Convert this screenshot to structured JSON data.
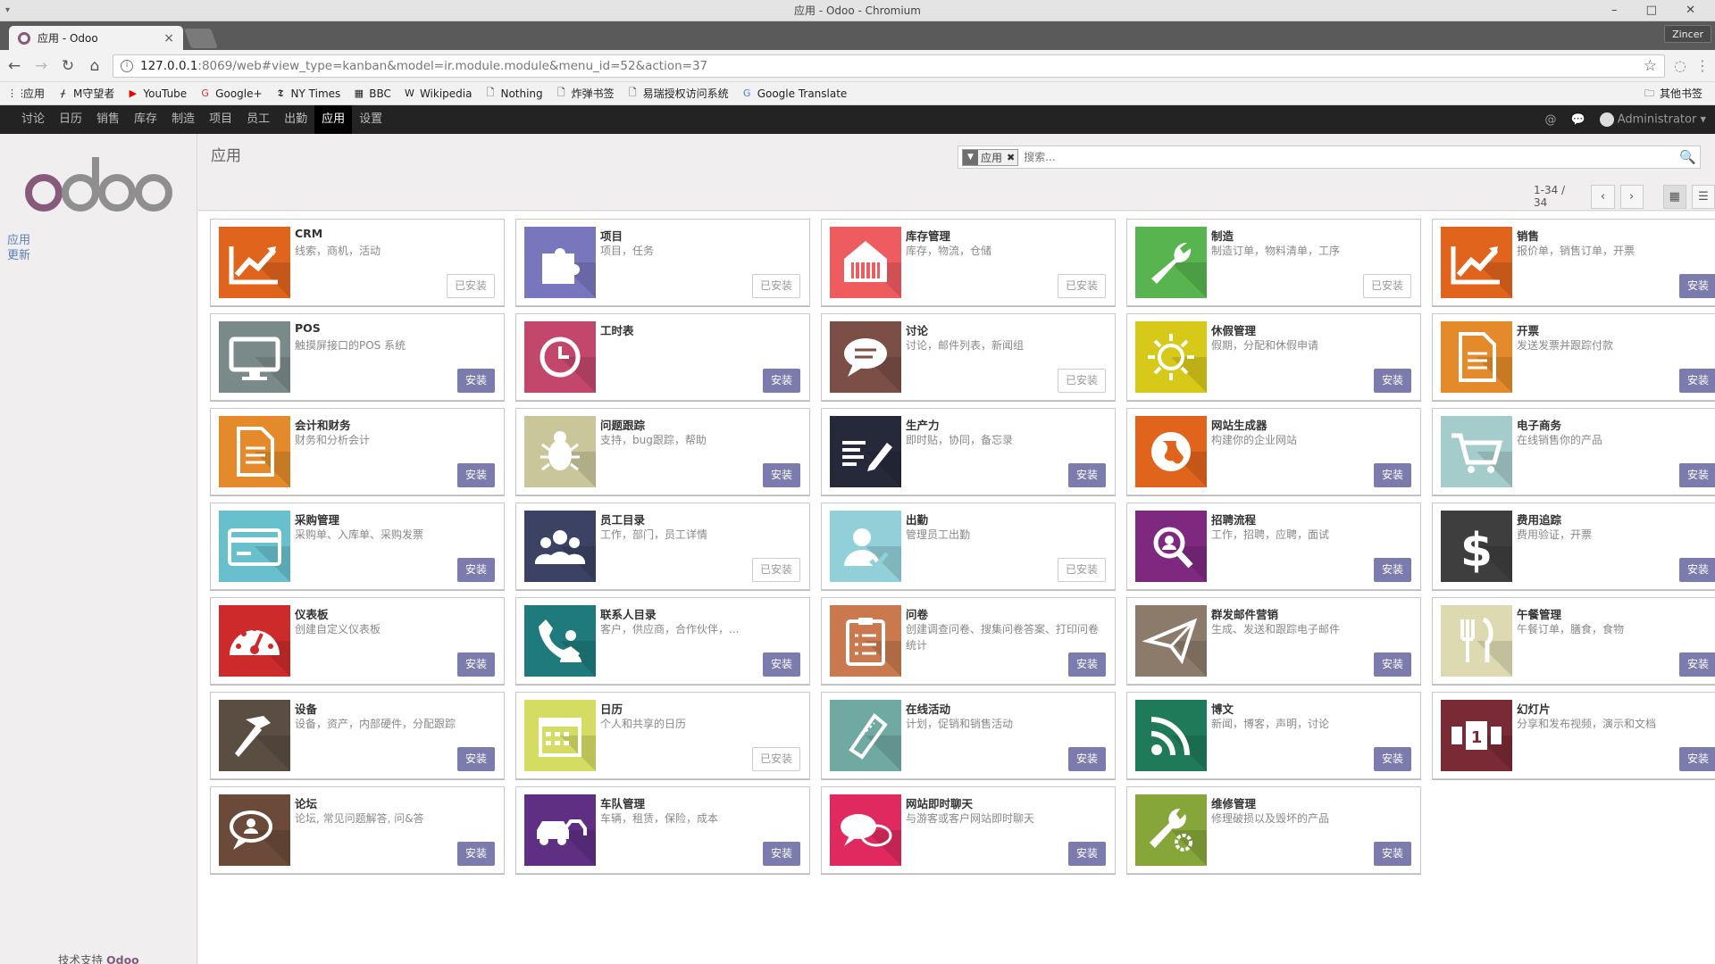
{
  "window": {
    "title": "应用 - Odoo - Chromium",
    "controls": "– □ ✕"
  },
  "browser": {
    "tab_title": "应用 - Odoo",
    "profile": "Zincer",
    "url_host": "127.0.0.1",
    "url_rest": ":8069/web#view_type=kanban&model=ir.module.module&menu_id=52&action=37",
    "bookmarks": [
      "应用",
      "M守望者",
      "YouTube",
      "Google+",
      "NY Times",
      "BBC",
      "Wikipedia",
      "Nothing",
      "炸弹书签",
      "易瑞授权访问系统",
      "Google Translate"
    ],
    "bookmarks_other": "其他书签"
  },
  "nav": {
    "menus": [
      "讨论",
      "日历",
      "销售",
      "库存",
      "制造",
      "项目",
      "员工",
      "出勤",
      "应用",
      "设置"
    ],
    "active": "应用",
    "user": "Administrator"
  },
  "sidebar": {
    "links": [
      "应用",
      "更新"
    ],
    "powered_prefix": "技术支持",
    "powered_brand": "Odoo"
  },
  "control_panel": {
    "breadcrumb": "应用",
    "facet": "应用",
    "search_placeholder": "搜索...",
    "pager": "1-34 / 34"
  },
  "labels": {
    "install": "安装",
    "installed": "已安装"
  },
  "apps": [
    {
      "name": "CRM",
      "summary": "线索，商机，活动",
      "installed": true,
      "bg": "#e1641c",
      "icon": "chart"
    },
    {
      "name": "项目",
      "summary": "项目，任务",
      "installed": true,
      "bg": "#7876bc",
      "icon": "puzzle"
    },
    {
      "name": "库存管理",
      "summary": "库存，物流，仓储",
      "installed": true,
      "bg": "#ef5c5f",
      "icon": "warehouse"
    },
    {
      "name": "制造",
      "summary": "制造订单，物料清单，工序",
      "installed": true,
      "bg": "#57b44e",
      "icon": "wrench"
    },
    {
      "name": "销售",
      "summary": "报价单，销售订单，开票",
      "installed": false,
      "bg": "#e1641c",
      "icon": "chart"
    },
    {
      "name": "POS",
      "summary": "触摸屏接口的POS 系统",
      "installed": false,
      "bg": "#7a8a8a",
      "icon": "monitor"
    },
    {
      "name": "工时表",
      "summary": "",
      "installed": false,
      "bg": "#c2476a",
      "icon": "clock"
    },
    {
      "name": "讨论",
      "summary": "讨论，邮件列表，新闻组",
      "installed": true,
      "bg": "#7b4e46",
      "icon": "chat"
    },
    {
      "name": "休假管理",
      "summary": "假期，分配和休假申请",
      "installed": false,
      "bg": "#d7c91a",
      "icon": "sun"
    },
    {
      "name": "开票",
      "summary": "发送发票并跟踪付款",
      "installed": false,
      "bg": "#e48a2a",
      "icon": "doc"
    },
    {
      "name": "会计和财务",
      "summary": "财务和分析会计",
      "installed": false,
      "bg": "#e48a2a",
      "icon": "doc"
    },
    {
      "name": "问题跟踪",
      "summary": "支持，bug跟踪，帮助",
      "installed": false,
      "bg": "#c9c69a",
      "icon": "bug"
    },
    {
      "name": "生产力",
      "summary": "即时贴，协同，备忘录",
      "installed": false,
      "bg": "#26293a",
      "icon": "note"
    },
    {
      "name": "网站生成器",
      "summary": "构建你的企业网站",
      "installed": false,
      "bg": "#e0641c",
      "icon": "globe"
    },
    {
      "name": "电子商务",
      "summary": "在线销售你的产品",
      "installed": false,
      "bg": "#a4ccca",
      "icon": "cart"
    },
    {
      "name": "采购管理",
      "summary": "采购单、入库单、采购发票",
      "installed": false,
      "bg": "#67c0cc",
      "icon": "card"
    },
    {
      "name": "员工目录",
      "summary": "工作，部门，员工详情",
      "installed": true,
      "bg": "#3b4263",
      "icon": "people"
    },
    {
      "name": "出勤",
      "summary": "管理员工出勤",
      "installed": true,
      "bg": "#91d0d8",
      "icon": "usercheck"
    },
    {
      "name": "招聘流程",
      "summary": "工作，招聘，应聘，面试",
      "installed": false,
      "bg": "#7e2880",
      "icon": "search"
    },
    {
      "name": "费用追踪",
      "summary": "费用验证，开票",
      "installed": false,
      "bg": "#3e3e3e",
      "icon": "dollar"
    },
    {
      "name": "仪表板",
      "summary": "创建自定义仪表板",
      "installed": false,
      "bg": "#cd2b2b",
      "icon": "gauge"
    },
    {
      "name": "联系人目录",
      "summary": "客户，供应商，合作伙伴，...",
      "installed": false,
      "bg": "#1f7a7c",
      "icon": "contact"
    },
    {
      "name": "问卷",
      "summary": "创建调查问卷、搜集问卷答案、打印问卷统计",
      "installed": false,
      "bg": "#c9794d",
      "icon": "clipboard"
    },
    {
      "name": "群发邮件营销",
      "summary": "生成、发送和跟踪电子邮件",
      "installed": false,
      "bg": "#8c7a6a",
      "icon": "plane"
    },
    {
      "name": "午餐管理",
      "summary": "午餐订单，膳食，食物",
      "installed": false,
      "bg": "#dddab2",
      "icon": "lunch"
    },
    {
      "name": "设备",
      "summary": "设备，资产，内部硬件，分配跟踪",
      "installed": false,
      "bg": "#5a4e43",
      "icon": "hammer"
    },
    {
      "name": "日历",
      "summary": "个人和共享的日历",
      "installed": true,
      "bg": "#d4dc62",
      "icon": "calendar"
    },
    {
      "name": "在线活动",
      "summary": "计划，促销和销售活动",
      "installed": false,
      "bg": "#70a8a2",
      "icon": "ticket"
    },
    {
      "name": "博文",
      "summary": "新闻，博客，声明，讨论",
      "installed": false,
      "bg": "#1f7a5a",
      "icon": "rss"
    },
    {
      "name": "幻灯片",
      "summary": "分享和发布视频，演示和文档",
      "installed": false,
      "bg": "#7a2a34",
      "icon": "slides"
    },
    {
      "name": "论坛",
      "summary": "论坛, 常见问题解答, 问&答",
      "installed": false,
      "bg": "#6b4a3a",
      "icon": "forum"
    },
    {
      "name": "车队管理",
      "summary": "车辆，租赁，保险，成本",
      "installed": false,
      "bg": "#5e2f82",
      "icon": "car"
    },
    {
      "name": "网站即时聊天",
      "summary": "与游客或客户网站即时聊天",
      "installed": false,
      "bg": "#e0295e",
      "icon": "bubbles"
    },
    {
      "name": "维修管理",
      "summary": "修理破损以及毁坏的产品",
      "installed": false,
      "bg": "#86a63a",
      "icon": "wrenchgear"
    }
  ]
}
